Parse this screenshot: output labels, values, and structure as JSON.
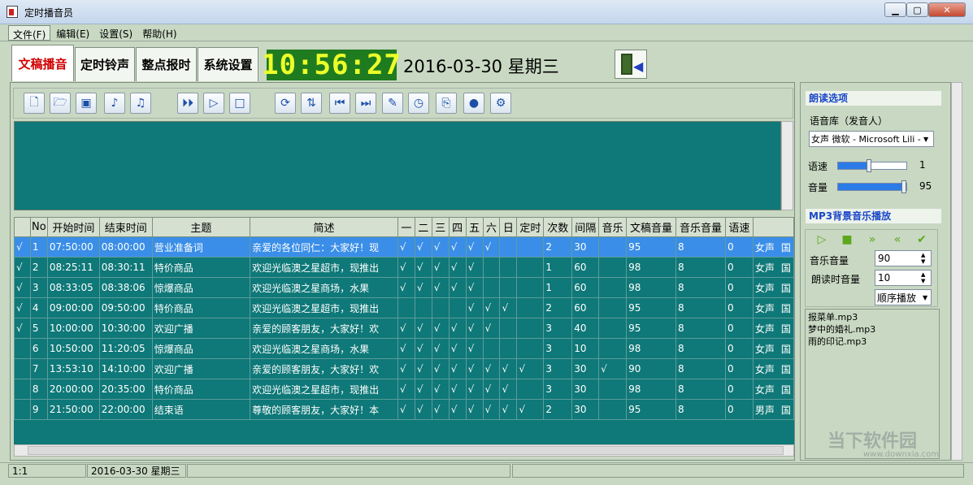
{
  "window": {
    "title": "定时播音员"
  },
  "menu": [
    "文件(F)",
    "编辑(E)",
    "设置(S)",
    "帮助(H)"
  ],
  "tabs": [
    "文稿播音",
    "定时铃声",
    "整点报时",
    "系统设置"
  ],
  "clock": "10:56:27",
  "date": "2016-03-30 星期三",
  "table": {
    "headers": [
      "",
      "No",
      "开始时间",
      "结束时间",
      "主题",
      "简述",
      "一",
      "二",
      "三",
      "四",
      "五",
      "六",
      "日",
      "定时",
      "次数",
      "间隔",
      "音乐",
      "文稿音量",
      "音乐音量",
      "语速",
      ""
    ],
    "rows": [
      [
        "√",
        "1",
        "07:50:00",
        "08:00:00",
        "营业准备词",
        "亲爱的各位同仁：大家好！现",
        "√",
        "√",
        "√",
        "√",
        "√",
        "√",
        "",
        "",
        "2",
        "30",
        "",
        "95",
        "8",
        "0",
        "女声",
        "国"
      ],
      [
        "√",
        "2",
        "08:25:11",
        "08:30:11",
        "特价商品",
        "欢迎光临澳之星超市，现推出",
        "√",
        "√",
        "√",
        "√",
        "√",
        "",
        "",
        "",
        "1",
        "60",
        "",
        "98",
        "8",
        "0",
        "女声",
        "国"
      ],
      [
        "√",
        "3",
        "08:33:05",
        "08:38:06",
        "惊爆商品",
        "欢迎光临澳之星商场，水果",
        "√",
        "√",
        "√",
        "√",
        "√",
        "",
        "",
        "",
        "1",
        "60",
        "",
        "98",
        "8",
        "0",
        "女声",
        "国"
      ],
      [
        "√",
        "4",
        "09:00:00",
        "09:50:00",
        "特价商品",
        "欢迎光临澳之星超市，现推出",
        "",
        "",
        "",
        "",
        "√",
        "√",
        "√",
        "",
        "2",
        "60",
        "",
        "95",
        "8",
        "0",
        "女声",
        "国"
      ],
      [
        "√",
        "5",
        "10:00:00",
        "10:30:00",
        "欢迎广播",
        "亲爱的顾客朋友，大家好！欢",
        "√",
        "√",
        "√",
        "√",
        "√",
        "√",
        "",
        "",
        "3",
        "40",
        "",
        "95",
        "8",
        "0",
        "女声",
        "国"
      ],
      [
        "",
        "6",
        "10:50:00",
        "11:20:05",
        "惊爆商品",
        "欢迎光临澳之星商场，水果",
        "√",
        "√",
        "√",
        "√",
        "√",
        "",
        "",
        "",
        "3",
        "10",
        "",
        "98",
        "8",
        "0",
        "女声",
        "国"
      ],
      [
        "",
        "7",
        "13:53:10",
        "14:10:00",
        "欢迎广播",
        "亲爱的顾客朋友，大家好！欢",
        "√",
        "√",
        "√",
        "√",
        "√",
        "√",
        "√",
        "√",
        "3",
        "30",
        "√",
        "90",
        "8",
        "0",
        "女声",
        "国"
      ],
      [
        "",
        "8",
        "20:00:00",
        "20:35:00",
        "特价商品",
        "欢迎光临澳之星超市，现推出",
        "√",
        "√",
        "√",
        "√",
        "√",
        "√",
        "√",
        "",
        "3",
        "30",
        "",
        "98",
        "8",
        "0",
        "女声",
        "国"
      ],
      [
        "",
        "9",
        "21:50:00",
        "22:00:00",
        "结束语",
        "尊敬的顾客朋友，大家好！本",
        "√",
        "√",
        "√",
        "√",
        "√",
        "√",
        "√",
        "√",
        "2",
        "30",
        "",
        "95",
        "8",
        "0",
        "男声",
        "国"
      ]
    ]
  },
  "reading": {
    "title": "朗读选项",
    "voice_label": "语音库（发音人）",
    "voice_value": "女声 微软 - Microsoft Lili - C",
    "speed_label": "语速",
    "speed_value": "1",
    "speed_level": 0.45,
    "volume_label": "音量",
    "volume_value": "95",
    "volume_level": 0.95
  },
  "mp3": {
    "title": "MP3背景音乐播放",
    "music_volume_label": "音乐音量",
    "music_volume_value": "90",
    "read_volume_label": "朗读时音量",
    "read_volume_value": "10",
    "mode": "顺序播放",
    "playlist": [
      "报菜单.mp3",
      "梦中的婚礼.mp3",
      "雨的印记.mp3"
    ]
  },
  "status": {
    "pos": "1:1",
    "date": "2016-03-30 星期三"
  },
  "watermark": {
    "text": "当下软件园",
    "url": "www.downxia.com"
  }
}
